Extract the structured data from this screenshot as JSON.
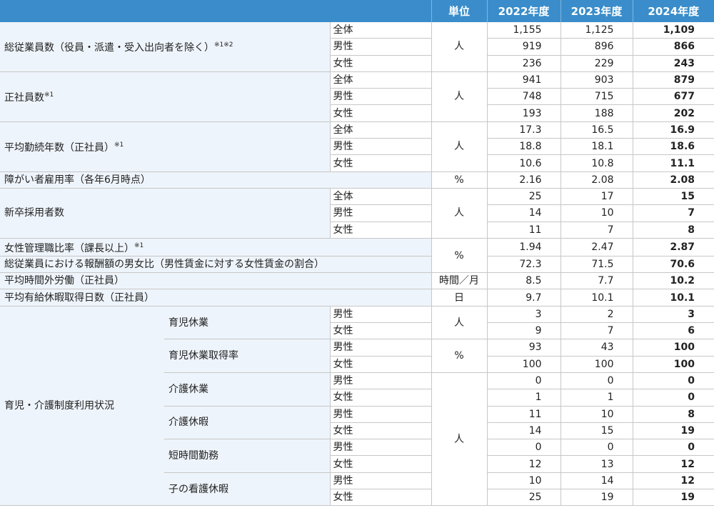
{
  "header": {
    "unit": "単位",
    "years": [
      "2022年度",
      "2023年度",
      "2024年度"
    ]
  },
  "rows": {
    "employees": {
      "label": "総従業員数（役員・派遣・受入出向者を除く）",
      "note": "※1※2",
      "unit": "人",
      "sub": [
        {
          "label": "全体",
          "v": [
            "1,155",
            "1,125",
            "1,109"
          ]
        },
        {
          "label": "男性",
          "v": [
            "919",
            "896",
            "866"
          ]
        },
        {
          "label": "女性",
          "v": [
            "236",
            "229",
            "243"
          ]
        }
      ]
    },
    "regular": {
      "label": "正社員数",
      "note": "※1",
      "unit": "人",
      "sub": [
        {
          "label": "全体",
          "v": [
            "941",
            "903",
            "879"
          ]
        },
        {
          "label": "男性",
          "v": [
            "748",
            "715",
            "677"
          ]
        },
        {
          "label": "女性",
          "v": [
            "193",
            "188",
            "202"
          ]
        }
      ]
    },
    "tenure": {
      "label": "平均勤続年数（正社員）",
      "note": "※1",
      "unit": "人",
      "sub": [
        {
          "label": "全体",
          "v": [
            "17.3",
            "16.5",
            "16.9"
          ]
        },
        {
          "label": "男性",
          "v": [
            "18.8",
            "18.1",
            "18.6"
          ]
        },
        {
          "label": "女性",
          "v": [
            "10.6",
            "10.8",
            "11.1"
          ]
        }
      ]
    },
    "disability": {
      "label": "障がい者雇用率（各年6月時点）",
      "unit": "%",
      "v": [
        "2.16",
        "2.08",
        "2.08"
      ]
    },
    "newgrad": {
      "label": "新卒採用者数",
      "unit": "人",
      "sub": [
        {
          "label": "全体",
          "v": [
            "25",
            "17",
            "15"
          ]
        },
        {
          "label": "男性",
          "v": [
            "14",
            "10",
            "7"
          ]
        },
        {
          "label": "女性",
          "v": [
            "11",
            "7",
            "8"
          ]
        }
      ]
    },
    "women_mgmt": {
      "label": "女性管理職比率（課長以上）",
      "note": "※1",
      "v": [
        "1.94",
        "2.47",
        "2.87"
      ]
    },
    "pay_ratio": {
      "label": "総従業員における報酬額の男女比（男性賃金に対する女性賃金の割合）",
      "v": [
        "72.3",
        "71.5",
        "70.6"
      ]
    },
    "pct_unit": "%",
    "overtime": {
      "label": "平均時間外労働（正社員）",
      "unit": "時間／月",
      "v": [
        "8.5",
        "7.7",
        "10.2"
      ]
    },
    "leave": {
      "label": "平均有給休暇取得日数（正社員）",
      "unit": "日",
      "v": [
        "9.7",
        "10.1",
        "10.1"
      ]
    },
    "childcare": {
      "label": "育児・介護制度利用状況",
      "ikuji": {
        "label": "育児休業",
        "unit": "人",
        "male": [
          "3",
          "2",
          "3"
        ],
        "female": [
          "9",
          "7",
          "6"
        ]
      },
      "ikuji_rate": {
        "label": "育児休業取得率",
        "unit": "%",
        "male": [
          "93",
          "43",
          "100"
        ],
        "female": [
          "100",
          "100",
          "100"
        ]
      },
      "care_unit": "人",
      "kaigo_kyugyo": {
        "label": "介護休業",
        "male": [
          "0",
          "0",
          "0"
        ],
        "female": [
          "1",
          "1",
          "0"
        ]
      },
      "kaigo_kyuka": {
        "label": "介護休暇",
        "male": [
          "11",
          "10",
          "8"
        ],
        "female": [
          "14",
          "15",
          "19"
        ]
      },
      "tanjikan": {
        "label": "短時間勤務",
        "male": [
          "0",
          "0",
          "0"
        ],
        "female": [
          "12",
          "13",
          "12"
        ]
      },
      "kango": {
        "label": "子の看護休暇",
        "male": [
          "10",
          "14",
          "12"
        ],
        "female": [
          "25",
          "19",
          "19"
        ]
      },
      "male_label": "男性",
      "female_label": "女性"
    }
  }
}
